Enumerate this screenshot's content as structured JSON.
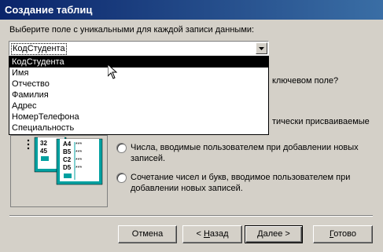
{
  "window": {
    "title": "Создание таблиц"
  },
  "prompt": "Выберите поле с уникальными для каждой записи данными:",
  "combo": {
    "value": "КодСтудента"
  },
  "dropdown": {
    "items": [
      "КодСтудента",
      "Имя",
      "Отчество",
      "Фамилия",
      "Адрес",
      "НомерТелефона",
      "Специальность"
    ],
    "selected_index": 0
  },
  "behind": {
    "line1": "ключевом поле?",
    "line2": "тически присваиваемые"
  },
  "illustration": {
    "rows": [
      "32",
      "45"
    ],
    "codes": [
      "A4",
      "B5",
      "C2",
      "D5"
    ],
    "mark": "***"
  },
  "options": [
    {
      "label": "Числа, вводимые пользователем при добавлении новых записей."
    },
    {
      "label": "Сочетание чисел и букв, вводимое пользователем при добавлении новых записей."
    }
  ],
  "buttons": {
    "cancel": "Отмена",
    "back_prefix": "< ",
    "back_hotkey": "Н",
    "back_rest": "азад",
    "next_hotkey": "Д",
    "next_rest": "алее >",
    "finish_hotkey": "Г",
    "finish_rest": "отово"
  }
}
